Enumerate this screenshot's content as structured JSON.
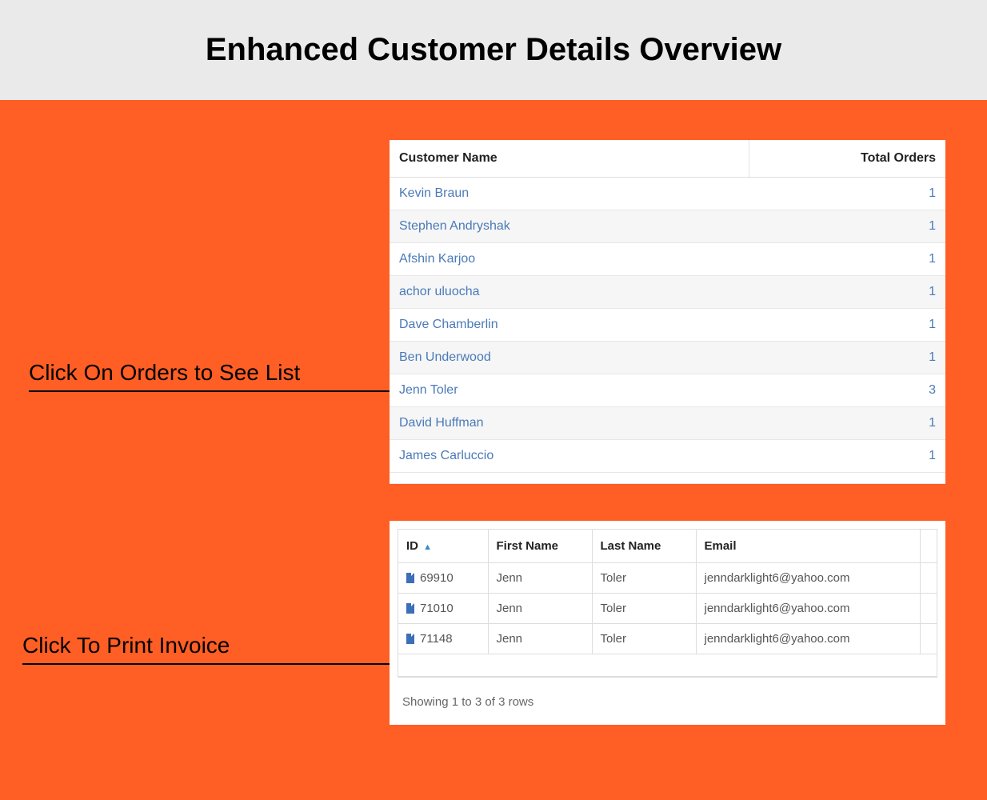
{
  "colors": {
    "accent": "#ff5e24",
    "link": "#4a7ab8",
    "icon": "#3b6fb7"
  },
  "header": {
    "title": "Enhanced Customer Details Overview"
  },
  "callouts": {
    "orders_list": "Click On Orders to See List",
    "print_invoice": "Click To Print Invoice"
  },
  "customers_table": {
    "columns": {
      "name": "Customer Name",
      "total": "Total Orders"
    },
    "rows": [
      {
        "name": "Kevin Braun",
        "total": "1"
      },
      {
        "name": "Stephen Andryshak",
        "total": "1"
      },
      {
        "name": "Afshin Karjoo",
        "total": "1"
      },
      {
        "name": "achor uluocha",
        "total": "1"
      },
      {
        "name": "Dave Chamberlin",
        "total": "1"
      },
      {
        "name": "Ben Underwood",
        "total": "1"
      },
      {
        "name": "Jenn Toler",
        "total": "3"
      },
      {
        "name": "David Huffman",
        "total": "1"
      },
      {
        "name": "James Carluccio",
        "total": "1"
      }
    ]
  },
  "orders_table": {
    "columns": {
      "id": "ID",
      "first": "First Name",
      "last": "Last Name",
      "email": "Email"
    },
    "sort_icon": "▲",
    "rows": [
      {
        "id": "69910",
        "first": "Jenn",
        "last": "Toler",
        "email": "jenndarklight6@yahoo.com"
      },
      {
        "id": "71010",
        "first": "Jenn",
        "last": "Toler",
        "email": "jenndarklight6@yahoo.com"
      },
      {
        "id": "71148",
        "first": "Jenn",
        "last": "Toler",
        "email": "jenndarklight6@yahoo.com"
      }
    ],
    "footer": "Showing 1 to 3 of 3 rows"
  }
}
